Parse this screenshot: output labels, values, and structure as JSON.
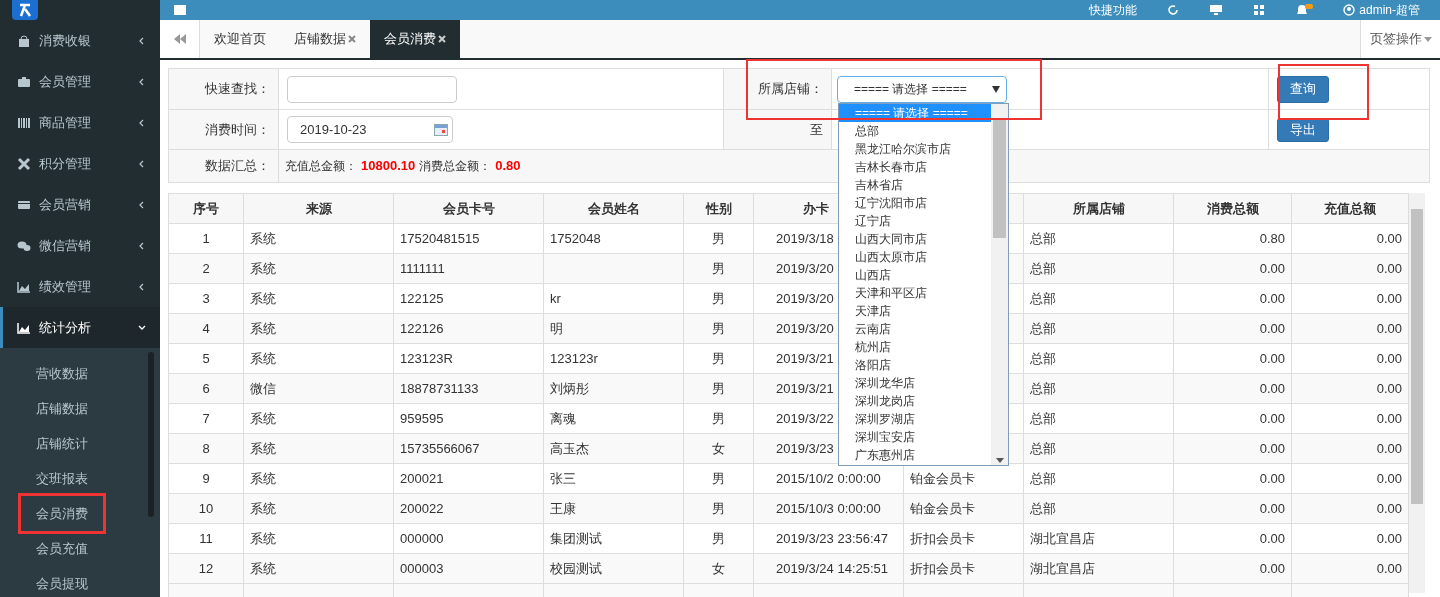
{
  "topbar": {
    "quick_link": "快捷功能",
    "user": "admin-超管"
  },
  "sidebar": {
    "items": [
      {
        "label": "消费收银",
        "expanded": false
      },
      {
        "label": "会员管理",
        "expanded": false
      },
      {
        "label": "商品管理",
        "expanded": false
      },
      {
        "label": "积分管理",
        "expanded": false
      },
      {
        "label": "会员营销",
        "expanded": false
      },
      {
        "label": "微信营销",
        "expanded": false
      },
      {
        "label": "绩效管理",
        "expanded": false
      },
      {
        "label": "统计分析",
        "expanded": true,
        "children": [
          {
            "label": "营收数据",
            "highlighted": false
          },
          {
            "label": "店铺数据",
            "highlighted": false
          },
          {
            "label": "店铺统计",
            "highlighted": false
          },
          {
            "label": "交班报表",
            "highlighted": false
          },
          {
            "label": "会员消费",
            "highlighted": true
          },
          {
            "label": "会员充值",
            "highlighted": false
          },
          {
            "label": "会员提现",
            "highlighted": false
          }
        ]
      }
    ]
  },
  "tabs": [
    {
      "label": "欢迎首页",
      "selected": false,
      "closable": false
    },
    {
      "label": "店铺数据",
      "selected": false,
      "closable": true
    },
    {
      "label": "会员消费",
      "selected": true,
      "closable": true
    }
  ],
  "tab_menu": "页签操作",
  "filters": {
    "quick_search": {
      "label": "快速查找："
    },
    "store": {
      "label": "所属店铺：",
      "value": "===== 请选择 =====",
      "open": true,
      "options": [
        {
          "label": "===== 请选择 =====",
          "selected": true
        },
        {
          "label": "总部",
          "selected": false
        },
        {
          "label": "黑龙江哈尔滨市店",
          "selected": false
        },
        {
          "label": "吉林长春市店",
          "selected": false
        },
        {
          "label": "吉林省店",
          "selected": false
        },
        {
          "label": "辽宁沈阳市店",
          "selected": false
        },
        {
          "label": "辽宁店",
          "selected": false
        },
        {
          "label": "山西大同市店",
          "selected": false
        },
        {
          "label": "山西太原市店",
          "selected": false
        },
        {
          "label": "山西店",
          "selected": false
        },
        {
          "label": "天津和平区店",
          "selected": false
        },
        {
          "label": "天津店",
          "selected": false
        },
        {
          "label": "云南店",
          "selected": false
        },
        {
          "label": "杭州店",
          "selected": false
        },
        {
          "label": "洛阳店",
          "selected": false
        },
        {
          "label": "深圳龙华店",
          "selected": false
        },
        {
          "label": "深圳龙岗店",
          "selected": false
        },
        {
          "label": "深圳罗湖店",
          "selected": false
        },
        {
          "label": "深圳宝安店",
          "selected": false
        },
        {
          "label": "广东惠州店",
          "selected": false
        }
      ]
    },
    "date": {
      "label": "消费时间：",
      "value": "2019-10-23",
      "to": "至"
    },
    "summary": {
      "label": "数据汇总：",
      "recharge_label": "充值总金额：",
      "recharge_value": "10800.10",
      "spend_label": "消费总金额：",
      "spend_value": "0.80"
    },
    "query_button": "查询",
    "export_button": "导出",
    "highlight_store": true,
    "highlight_query": true
  },
  "table": {
    "columns": [
      "序号",
      "来源",
      "会员卡号",
      "会员姓名",
      "性别",
      "办卡",
      null,
      "所属店铺",
      "消费总额",
      "充值总额"
    ],
    "rows": [
      [
        "1",
        "系统",
        "17520481515",
        "1752048",
        "男",
        "2019/3/18",
        null,
        "总部",
        "0.80",
        "0.00"
      ],
      [
        "2",
        "系统",
        "1111111",
        null,
        "男",
        "2019/3/20",
        null,
        "总部",
        "0.00",
        "0.00"
      ],
      [
        "3",
        "系统",
        "122125",
        "kr",
        "男",
        "2019/3/20",
        null,
        "总部",
        "0.00",
        "0.00"
      ],
      [
        "4",
        "系统",
        "122126",
        "明",
        "男",
        "2019/3/20",
        null,
        "总部",
        "0.00",
        "0.00"
      ],
      [
        "5",
        "系统",
        "123123R",
        "123123r",
        "男",
        "2019/3/21",
        null,
        "总部",
        "0.00",
        "0.00"
      ],
      [
        "6",
        "微信",
        "18878731133",
        "刘炳彤",
        "男",
        "2019/3/21",
        null,
        "总部",
        "0.00",
        "0.00"
      ],
      [
        "7",
        "系统",
        "959595",
        "离魂",
        "男",
        "2019/3/22",
        null,
        "总部",
        "0.00",
        "0.00"
      ],
      [
        "8",
        "系统",
        "15735566067",
        "高玉杰",
        "女",
        "2019/3/23",
        null,
        "总部",
        "0.00",
        "0.00"
      ],
      [
        "9",
        "系统",
        "200021",
        "张三",
        "男",
        "2015/10/2 0:00:00",
        "铂金会员卡",
        "总部",
        "0.00",
        "0.00"
      ],
      [
        "10",
        "系统",
        "200022",
        "王康",
        "男",
        "2015/10/3 0:00:00",
        "铂金会员卡",
        "总部",
        "0.00",
        "0.00"
      ],
      [
        "11",
        "系统",
        "000000",
        "集团测试",
        "男",
        "2019/3/23 23:56:47",
        "折扣会员卡",
        "湖北宜昌店",
        "0.00",
        "0.00"
      ],
      [
        "12",
        "系统",
        "000003",
        "校园测试",
        "女",
        "2019/3/24 14:25:51",
        "折扣会员卡",
        "湖北宜昌店",
        "0.00",
        "0.00"
      ]
    ]
  }
}
